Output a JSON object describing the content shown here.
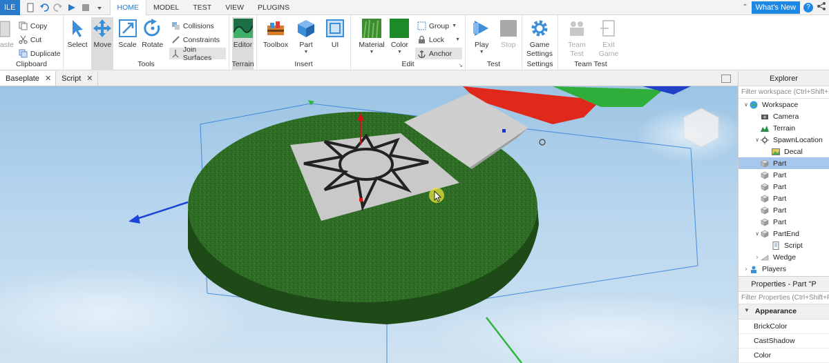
{
  "menubar": {
    "file_label": "ILE",
    "tabs": [
      "HOME",
      "MODEL",
      "TEST",
      "VIEW",
      "PLUGINS"
    ],
    "whats_new": "What's New",
    "help": "?"
  },
  "ribbon": {
    "clipboard": {
      "label": "Clipboard",
      "paste": "aste",
      "copy": "Copy",
      "cut": "Cut",
      "duplicate": "Duplicate"
    },
    "tools": {
      "label": "Tools",
      "select": "Select",
      "move": "Move",
      "scale": "Scale",
      "rotate": "Rotate",
      "collisions": "Collisions",
      "constraints": "Constraints",
      "join_surfaces": "Join Surfaces"
    },
    "terrain": {
      "label": "Terrain",
      "editor": "Editor"
    },
    "insert": {
      "label": "Insert",
      "toolbox": "Toolbox",
      "part": "Part",
      "ui": "UI"
    },
    "edit": {
      "label": "Edit",
      "material": "Material",
      "color": "Color",
      "group": "Group",
      "lock": "Lock",
      "anchor": "Anchor"
    },
    "test": {
      "label": "Test",
      "play": "Play",
      "stop": "Stop"
    },
    "settings": {
      "label": "Settings",
      "game_settings_1": "Game",
      "game_settings_2": "Settings"
    },
    "team_test": {
      "label": "Team Test",
      "team_test_1": "Team",
      "team_test_2": "Test",
      "exit_game_1": "Exit",
      "exit_game_2": "Game"
    }
  },
  "doctabs": [
    "Baseplate",
    "Script"
  ],
  "explorer": {
    "title": "Explorer",
    "filter_placeholder": "Filter workspace (Ctrl+Shift+X)",
    "nodes": [
      {
        "label": "Workspace",
        "indent": 0,
        "arrow": "expanded",
        "icon": "workspace-icon",
        "selected": false
      },
      {
        "label": "Camera",
        "indent": 1,
        "arrow": "none",
        "icon": "camera-icon",
        "selected": false
      },
      {
        "label": "Terrain",
        "indent": 1,
        "arrow": "none",
        "icon": "terrain-icon",
        "selected": false
      },
      {
        "label": "SpawnLocation",
        "indent": 1,
        "arrow": "expanded",
        "icon": "spawn-icon",
        "selected": false
      },
      {
        "label": "Decal",
        "indent": 2,
        "arrow": "none",
        "icon": "decal-icon",
        "selected": false
      },
      {
        "label": "Part",
        "indent": 1,
        "arrow": "none",
        "icon": "part-icon",
        "selected": true
      },
      {
        "label": "Part",
        "indent": 1,
        "arrow": "none",
        "icon": "part-icon",
        "selected": false
      },
      {
        "label": "Part",
        "indent": 1,
        "arrow": "none",
        "icon": "part-icon",
        "selected": false
      },
      {
        "label": "Part",
        "indent": 1,
        "arrow": "none",
        "icon": "part-icon",
        "selected": false
      },
      {
        "label": "Part",
        "indent": 1,
        "arrow": "none",
        "icon": "part-icon",
        "selected": false
      },
      {
        "label": "Part",
        "indent": 1,
        "arrow": "none",
        "icon": "part-icon",
        "selected": false
      },
      {
        "label": "PartEnd",
        "indent": 1,
        "arrow": "expanded",
        "icon": "part-icon",
        "selected": false
      },
      {
        "label": "Script",
        "indent": 2,
        "arrow": "none",
        "icon": "script-icon",
        "selected": false
      },
      {
        "label": "Wedge",
        "indent": 1,
        "arrow": "collapsed",
        "icon": "wedge-icon",
        "selected": false
      },
      {
        "label": "Players",
        "indent": 0,
        "arrow": "collapsed",
        "icon": "players-icon",
        "selected": false
      }
    ]
  },
  "properties": {
    "title": "Properties - Part \"P",
    "filter_placeholder": "Filter Properties (Ctrl+Shift+P)",
    "category": "Appearance",
    "rows": [
      "BrickColor",
      "CastShadow",
      "Color"
    ]
  },
  "colors": {
    "accent": "#2b79c9",
    "selection": "#a7c7ee",
    "grass": "#2d6a22",
    "sky": "#b8d6ee"
  }
}
